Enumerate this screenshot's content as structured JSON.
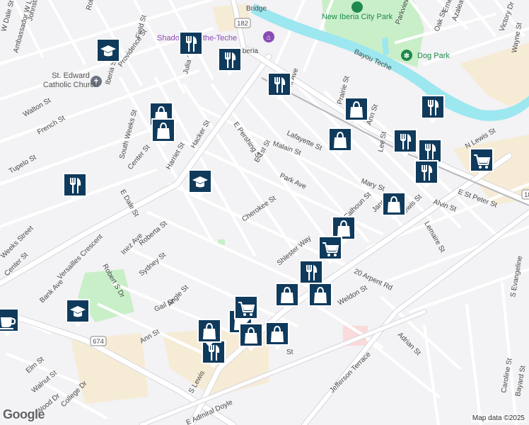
{
  "map": {
    "colors": {
      "background": "#f3f2f4",
      "road": "#ffffff",
      "road_outline": "#d6d6dc",
      "water": "#9ce7f0",
      "park": "#c9efc9",
      "commercial": "#f6ecd6",
      "marker": "#0f3a5c",
      "poi_purple": "#8a4bb5",
      "poi_green": "#1f8a4c"
    },
    "street_labels": [
      {
        "text": "Johnston St"
      },
      {
        "text": "Ambassador W Lemell Dr"
      },
      {
        "text": "W Dale St"
      },
      {
        "text": "Robertson St"
      },
      {
        "text": "Field St"
      },
      {
        "text": "Providence St"
      },
      {
        "text": "Iberia St"
      },
      {
        "text": "Julia St"
      },
      {
        "text": "South Weeks St"
      },
      {
        "text": "Walton St"
      },
      {
        "text": "French St"
      },
      {
        "text": "Tupelo St"
      },
      {
        "text": "Center St"
      },
      {
        "text": "Harriet St"
      },
      {
        "text": "Hacker St"
      },
      {
        "text": "E Pershing St"
      },
      {
        "text": "E 1st St"
      },
      {
        "text": "Park Ave"
      },
      {
        "text": "Malain St"
      },
      {
        "text": "Lafayette St"
      },
      {
        "text": "Prairie St"
      },
      {
        "text": "Ann St"
      },
      {
        "text": "Lee St"
      },
      {
        "text": "Mary St"
      },
      {
        "text": "N Lewis St"
      },
      {
        "text": "E St Peter St"
      },
      {
        "text": "Alvin St"
      },
      {
        "text": "Lemaire St"
      },
      {
        "text": "Cherokee St"
      },
      {
        "text": "Calhoun St"
      },
      {
        "text": "Jane St"
      },
      {
        "text": "Lewis St"
      },
      {
        "text": "E Dale St"
      },
      {
        "text": "Versailles Crescent"
      },
      {
        "text": "Inez Ave"
      },
      {
        "text": "Roberta St"
      },
      {
        "text": "Robert S Dr"
      },
      {
        "text": "Sydney St"
      },
      {
        "text": "Bank Ave"
      },
      {
        "text": "Gail St"
      },
      {
        "text": "Angle St"
      },
      {
        "text": "Shlester Way"
      },
      {
        "text": "20 Arpent Rd"
      },
      {
        "text": "Weldon St"
      },
      {
        "text": "Ann St"
      },
      {
        "text": "Elm St"
      },
      {
        "text": "Walnut St"
      },
      {
        "text": "College Dr"
      },
      {
        "text": "Jefferson Terrace"
      },
      {
        "text": "Adrian St"
      },
      {
        "text": "Caroline St"
      },
      {
        "text": "Bayard St"
      },
      {
        "text": "S Evangeline"
      },
      {
        "text": "Oak St"
      },
      {
        "text": "Azalea Dr"
      },
      {
        "text": "Ernest St"
      },
      {
        "text": "Victory Dr"
      },
      {
        "text": "Wayne St"
      },
      {
        "text": "Parkview Dr"
      },
      {
        "text": "Park Ave"
      },
      {
        "text": "Bayou Teche"
      },
      {
        "text": "S Lewis"
      },
      {
        "text": "E Admiral Doyle"
      },
      {
        "text": "Weeks Street"
      },
      {
        "text": "Center St"
      },
      {
        "text": "Wood Dr"
      },
      {
        "text": "St"
      },
      {
        "text": "Bridge"
      },
      {
        "text": "w Iberia"
      }
    ],
    "poi_labels": [
      {
        "text": "New Iberia City Park"
      },
      {
        "text": "Dog Park"
      },
      {
        "text": "St. Edward Catholic Church"
      },
      {
        "text": "Shadows-on-the-Teche"
      }
    ],
    "route_shields": [
      {
        "text": "182"
      },
      {
        "text": "674"
      },
      {
        "text": "182"
      }
    ],
    "markers": [
      {
        "icon": "restaurant-icon"
      },
      {
        "icon": "restaurant-icon"
      },
      {
        "icon": "restaurant-icon"
      },
      {
        "icon": "restaurant-icon"
      },
      {
        "icon": "restaurant-icon"
      },
      {
        "icon": "restaurant-icon"
      },
      {
        "icon": "restaurant-icon"
      },
      {
        "icon": "restaurant-icon"
      },
      {
        "icon": "restaurant-icon"
      },
      {
        "icon": "restaurant-icon"
      },
      {
        "icon": "shopping-bag-icon"
      },
      {
        "icon": "shopping-bag-icon"
      },
      {
        "icon": "shopping-bag-icon"
      },
      {
        "icon": "shopping-bag-icon"
      },
      {
        "icon": "shopping-bag-icon"
      },
      {
        "icon": "shopping-bag-icon"
      },
      {
        "icon": "shopping-bag-icon"
      },
      {
        "icon": "shopping-bag-icon"
      },
      {
        "icon": "shopping-bag-icon"
      },
      {
        "icon": "shopping-bag-icon"
      },
      {
        "icon": "shopping-bag-icon"
      },
      {
        "icon": "shopping-bag-icon"
      },
      {
        "icon": "shopping-cart-icon"
      },
      {
        "icon": "shopping-cart-icon"
      },
      {
        "icon": "shopping-cart-icon"
      },
      {
        "icon": "school-icon"
      },
      {
        "icon": "school-icon"
      },
      {
        "icon": "school-icon"
      },
      {
        "icon": "coffee-icon"
      }
    ]
  },
  "attribution": {
    "logo": "Google",
    "text": "Map data ©2025"
  }
}
